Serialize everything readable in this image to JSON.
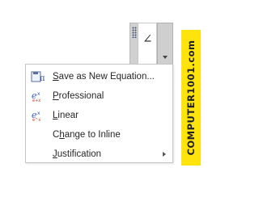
{
  "equation_control": {
    "symbol": "∠",
    "dropdown_icon": "chevron-down-icon"
  },
  "menu": {
    "items": [
      {
        "label_underline": "S",
        "label_rest": "ave as New Equation...",
        "icon": "pi-save-icon"
      },
      {
        "label_underline": "P",
        "label_rest": "rofessional",
        "icon": "professional-equation-icon"
      },
      {
        "label_underline": "L",
        "label_rest": "inear",
        "icon": "linear-equation-icon"
      },
      {
        "label_pre": "C",
        "label_underline": "h",
        "label_rest": "ange to Inline",
        "icon": ""
      },
      {
        "label_underline": "J",
        "label_rest": "ustification",
        "icon": "",
        "has_submenu": true
      }
    ]
  },
  "watermark": {
    "text": "COMPUTER1001.com",
    "color": "#ffe30c"
  },
  "colors": {
    "menu_text": "#262626",
    "icon_blue": "#3b5fa8",
    "icon_red": "#c0392b"
  }
}
